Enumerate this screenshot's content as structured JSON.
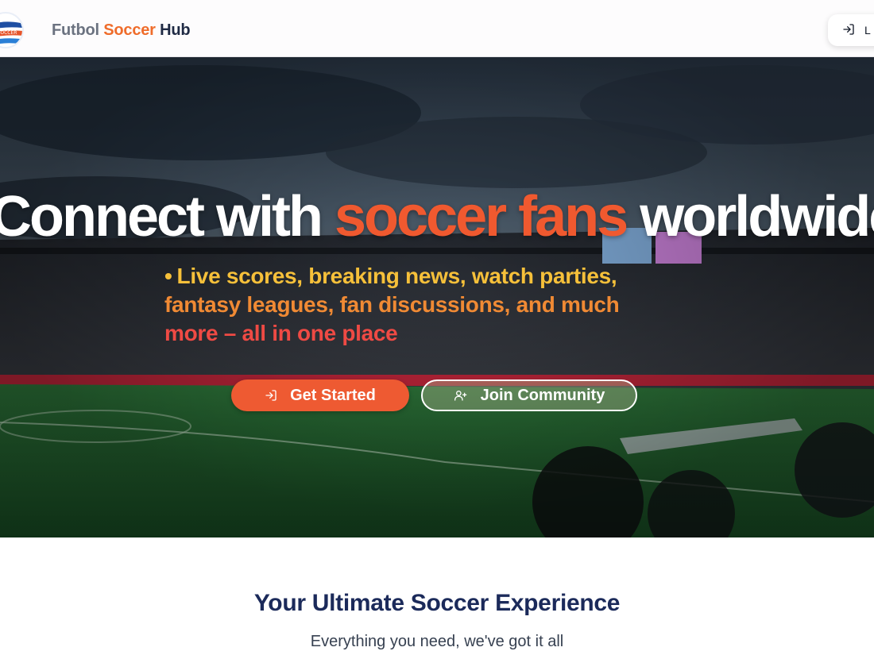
{
  "header": {
    "brand": {
      "part1": "Futbol",
      "part2": "Soccer",
      "part3": "Hub"
    },
    "logo_icon": "soccer-logo",
    "login": {
      "label": "L",
      "icon": "login-icon"
    }
  },
  "hero": {
    "headline": {
      "part1": "Connect with",
      "part2": "soccer fans",
      "part3": "worldwide"
    },
    "subtitle": {
      "bullet": "•",
      "line1": "Live scores, breaking news, watch parties,",
      "line2": "fantasy leagues, fan discussions, and much",
      "line3": "more – all in one place"
    },
    "buttons": {
      "primary": {
        "label": "Get Started",
        "icon": "sign-in-icon"
      },
      "secondary": {
        "label": "Join Community",
        "icon": "user-plus-icon"
      }
    },
    "background": "soccer-stadium-photo"
  },
  "features": {
    "title": "Your Ultimate Soccer Experience",
    "subtitle": "Everything you need, we've got it all"
  },
  "colors": {
    "accent": "#ee5a32",
    "brand_gray": "#6b7280",
    "navy": "#1b2a5a"
  }
}
